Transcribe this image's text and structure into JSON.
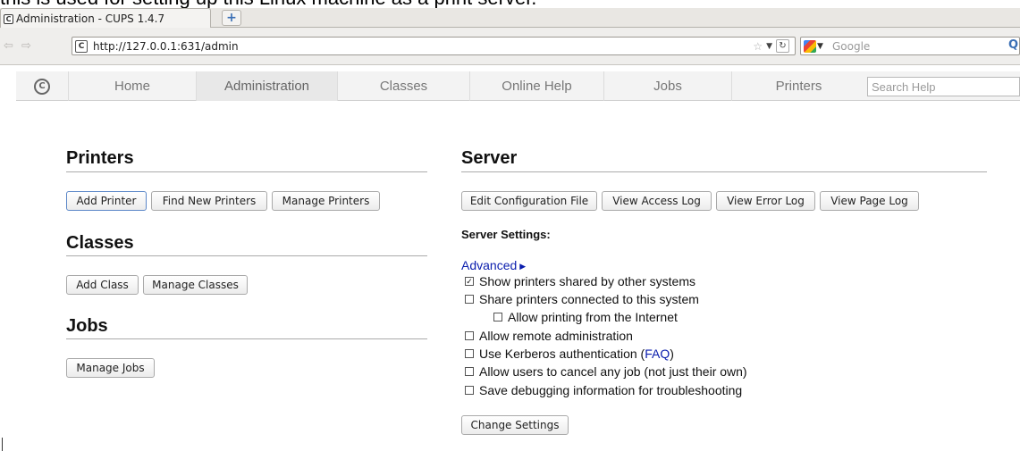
{
  "caption": "this is used for setting up this Linux machine as a print server.",
  "browser": {
    "tab_title": "Administration - CUPS 1.4.7",
    "url": "http://127.0.0.1:631/admin",
    "search_placeholder": "Google"
  },
  "menu": {
    "items": [
      "Home",
      "Administration",
      "Classes",
      "Online Help",
      "Jobs",
      "Printers"
    ],
    "active_index": 1,
    "search_placeholder": "Search Help"
  },
  "printers": {
    "title": "Printers",
    "add": "Add Printer",
    "find": "Find New Printers",
    "manage": "Manage Printers"
  },
  "classes": {
    "title": "Classes",
    "add": "Add Class",
    "manage": "Manage Classes"
  },
  "jobs": {
    "title": "Jobs",
    "manage": "Manage Jobs"
  },
  "server": {
    "title": "Server",
    "edit_config": "Edit Configuration File",
    "access_log": "View Access Log",
    "error_log": "View Error Log",
    "page_log": "View Page Log",
    "settings_heading": "Server Settings:",
    "advanced": "Advanced",
    "options": {
      "show_shared": {
        "label": "Show printers shared by other systems",
        "checked": true
      },
      "share": {
        "label": "Share printers connected to this system",
        "checked": false
      },
      "internet": {
        "label": "Allow printing from the Internet",
        "checked": false
      },
      "remote_admin": {
        "label": "Allow remote administration",
        "checked": false
      },
      "kerberos": {
        "label": "Use Kerberos authentication (",
        "faq": "FAQ",
        "close": ")",
        "checked": false
      },
      "cancel_any": {
        "label": "Allow users to cancel any job (not just their own)",
        "checked": false
      },
      "debug": {
        "label": "Save debugging information for troubleshooting",
        "checked": false
      }
    },
    "change_settings": "Change Settings"
  }
}
